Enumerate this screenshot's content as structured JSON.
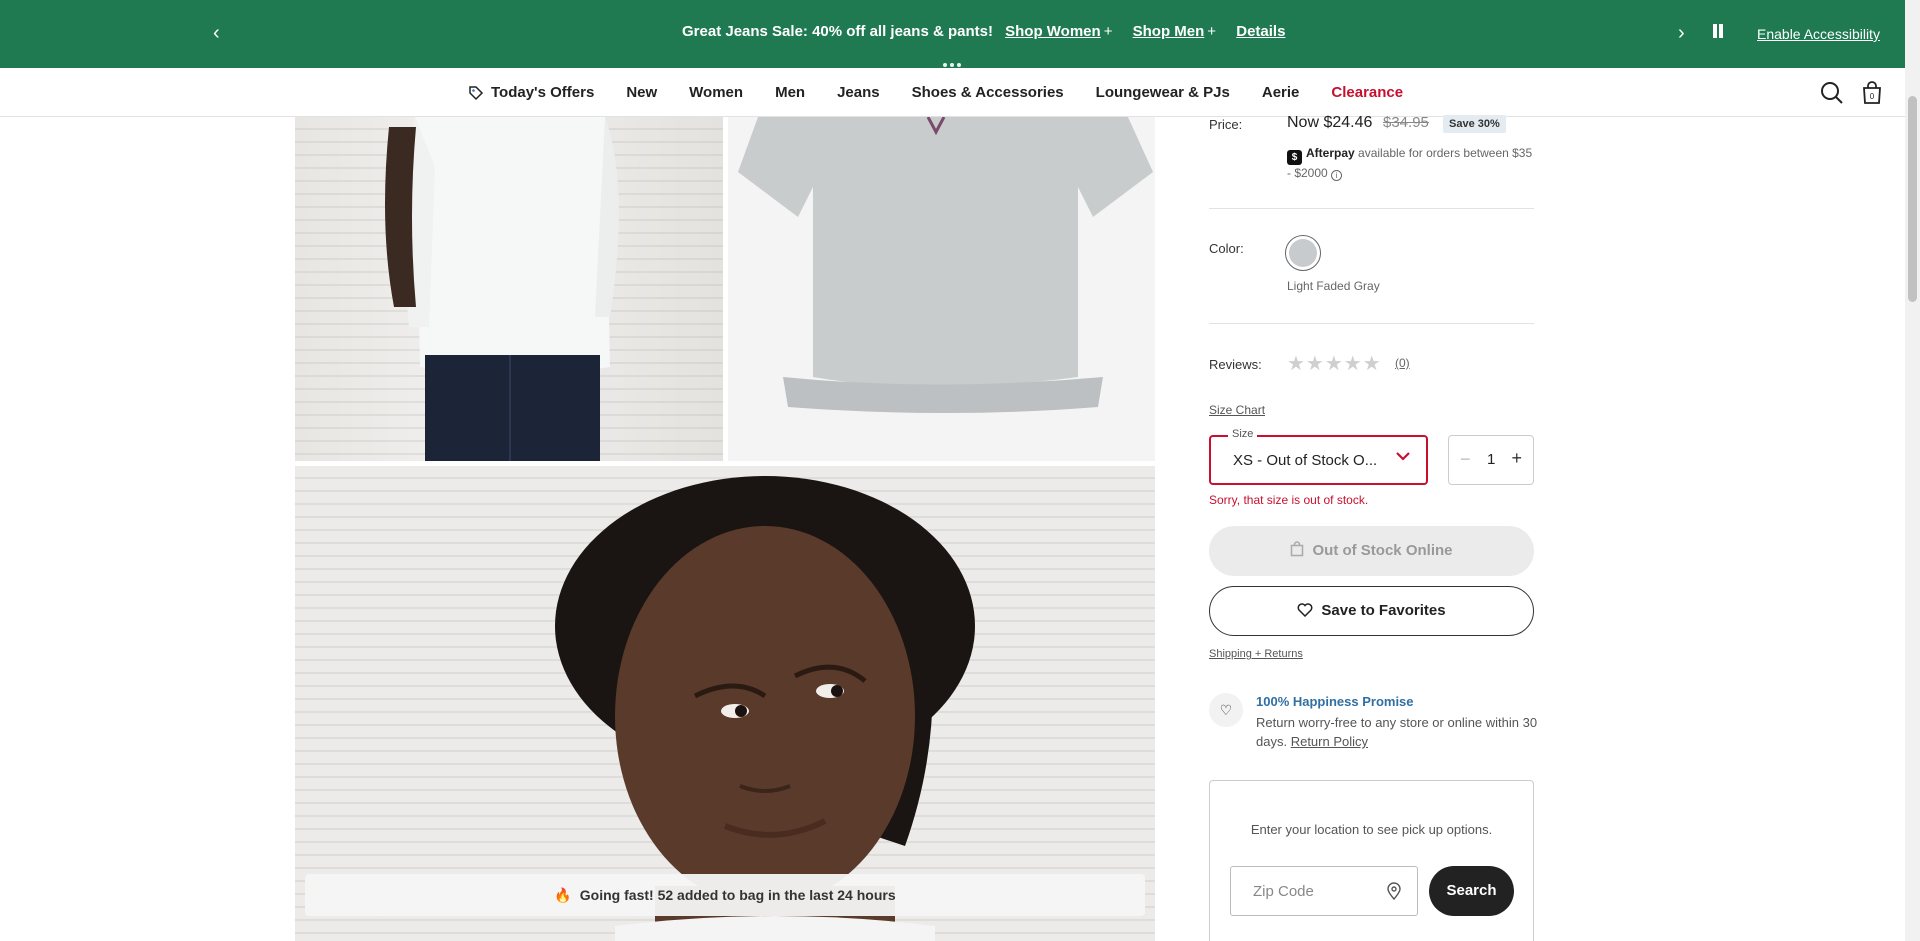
{
  "promo": {
    "message": "Great Jeans Sale: 40% off all jeans & pants!",
    "shop_women": "Shop Women",
    "shop_men": "Shop Men",
    "details": "Details",
    "plus_glyph": "+",
    "prev_glyph": "‹",
    "next_glyph": "›",
    "enable_accessibility": "Enable Accessibility",
    "background_color": "#1f7a52"
  },
  "nav": {
    "items": [
      {
        "label": "Today's Offers",
        "icon": "tag-icon"
      },
      {
        "label": "New"
      },
      {
        "label": "Women"
      },
      {
        "label": "Men"
      },
      {
        "label": "Jeans"
      },
      {
        "label": "Shoes & Accessories"
      },
      {
        "label": "Loungewear & PJs"
      },
      {
        "label": "Aerie"
      },
      {
        "label": "Clearance",
        "color": "#c8102e"
      }
    ],
    "bag_count": "0"
  },
  "gallery": {
    "going_fast": "Going fast! 52 added to bag in the last 24 hours",
    "flame_glyph": "🔥"
  },
  "product": {
    "price_label": "Price:",
    "price_now": "Now $24.46",
    "price_old": "$34.95",
    "save_badge": "Save 30%",
    "afterpay_brand": "Afterpay",
    "afterpay_text": "available for orders between $35 - $2000",
    "afterpay_logo": "$",
    "color_label": "Color:",
    "color_name": "Light Faded Gray",
    "swatch_color": "#c7cbcd",
    "reviews_label": "Reviews:",
    "stars": "★★★★★",
    "review_count": "(0)",
    "rating": 0,
    "size_chart": "Size Chart",
    "size_legend": "Size",
    "size_value": "XS - Out of Stock O...",
    "quantity": "1",
    "size_error": "Sorry, that size is out of stock.",
    "out_of_stock_button": "Out of Stock Online",
    "favorites_button": "Save to Favorites",
    "shipping_link": "Shipping + Returns",
    "happiness_title": "100% Happiness Promise",
    "happiness_text": "Return worry-free to any store or online within 30 days.",
    "return_policy": "Return Policy",
    "pickup_text": "Enter your location to see pick up options.",
    "zip_placeholder": "Zip Code",
    "search_button": "Search",
    "error_color": "#c8102e"
  }
}
